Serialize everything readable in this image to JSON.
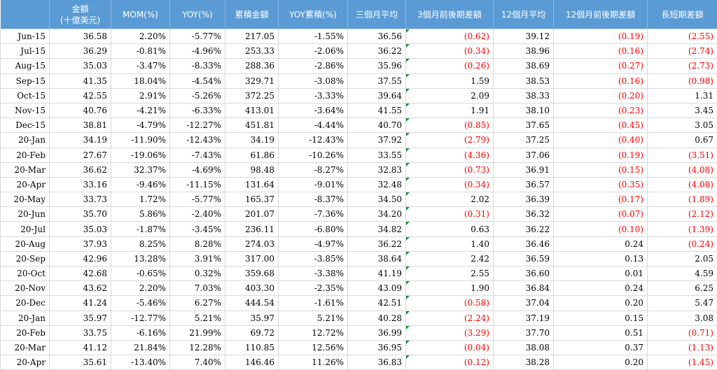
{
  "table": {
    "headers": [
      "",
      "金額\n(十億美元)",
      "MOM(%)",
      "YOY(%)",
      "累積金額",
      "YOY累積(%)",
      "三個月平均",
      "3個月前後期差額",
      "12個月平均",
      "12個月前後期差額",
      "長短期差額"
    ],
    "rows": [
      [
        "Jun-15",
        "36.58",
        "2.20%",
        "-5.77%",
        "217.05",
        "-1.55%",
        "36.56",
        "(0.62)",
        "39.12",
        "(0.19)",
        "(2.55)"
      ],
      [
        "Jul-15",
        "36.29",
        "-0.81%",
        "-4.96%",
        "253.33",
        "-2.06%",
        "36.22",
        "(0.34)",
        "38.96",
        "(0.16)",
        "(2.74)"
      ],
      [
        "Aug-15",
        "35.03",
        "-3.47%",
        "-8.33%",
        "288.36",
        "-2.86%",
        "35.96",
        "(0.26)",
        "38.69",
        "(0.27)",
        "(2.73)"
      ],
      [
        "Sep-15",
        "41.35",
        "18.04%",
        "-4.54%",
        "329.71",
        "-3.08%",
        "37.55",
        "1.59",
        "38.53",
        "(0.16)",
        "(0.98)"
      ],
      [
        "Oct-15",
        "42.55",
        "2.91%",
        "-5.26%",
        "372.25",
        "-3.33%",
        "39.64",
        "2.09",
        "38.33",
        "(0.20)",
        "1.31"
      ],
      [
        "Nov-15",
        "40.76",
        "-4.21%",
        "-6.33%",
        "413.01",
        "-3.64%",
        "41.55",
        "1.91",
        "38.10",
        "(0.23)",
        "3.45"
      ],
      [
        "Dec-15",
        "38.81",
        "-4.79%",
        "-12.27%",
        "451.81",
        "-4.44%",
        "40.70",
        "(0.85)",
        "37.65",
        "(0.45)",
        "3.05"
      ],
      [
        "20-Jan",
        "34.19",
        "-11.90%",
        "-12.43%",
        "34.19",
        "-12.43%",
        "37.92",
        "(2.79)",
        "37.25",
        "(0.40)",
        "0.67"
      ],
      [
        "20-Feb",
        "27.67",
        "-19.06%",
        "-7.43%",
        "61.86",
        "-10.26%",
        "33.55",
        "(4.36)",
        "37.06",
        "(0.19)",
        "(3.51)"
      ],
      [
        "20-Mar",
        "36.62",
        "32.37%",
        "-4.69%",
        "98.48",
        "-8.27%",
        "32.83",
        "(0.73)",
        "36.91",
        "(0.15)",
        "(4.08)"
      ],
      [
        "20-Apr",
        "33.16",
        "-9.46%",
        "-11.15%",
        "131.64",
        "-9.01%",
        "32.48",
        "(0.34)",
        "36.57",
        "(0.35)",
        "(4.08)"
      ],
      [
        "20-May",
        "33.73",
        "1.72%",
        "-5.77%",
        "165.37",
        "-8.37%",
        "34.50",
        "2.02",
        "36.39",
        "(0.17)",
        "(1.89)"
      ],
      [
        "20-Jun",
        "35.70",
        "5.86%",
        "-2.40%",
        "201.07",
        "-7.36%",
        "34.20",
        "(0.31)",
        "36.32",
        "(0.07)",
        "(2.12)"
      ],
      [
        "20-Jul",
        "35.03",
        "-1.87%",
        "-3.45%",
        "236.11",
        "-6.80%",
        "34.82",
        "0.63",
        "36.22",
        "(0.10)",
        "(1.39)"
      ],
      [
        "20-Aug",
        "37.93",
        "8.25%",
        "8.28%",
        "274.03",
        "-4.97%",
        "36.22",
        "1.40",
        "36.46",
        "0.24",
        "(0.24)"
      ],
      [
        "20-Sep",
        "42.96",
        "13.28%",
        "3.91%",
        "317.00",
        "-3.85%",
        "38.64",
        "2.42",
        "36.59",
        "0.13",
        "2.05"
      ],
      [
        "20-Oct",
        "42.68",
        "-0.65%",
        "0.32%",
        "359.68",
        "-3.38%",
        "41.19",
        "2.55",
        "36.60",
        "0.01",
        "4.59"
      ],
      [
        "20-Nov",
        "43.62",
        "2.20%",
        "7.03%",
        "403.30",
        "-2.35%",
        "43.09",
        "1.90",
        "36.84",
        "0.24",
        "6.25"
      ],
      [
        "20-Dec",
        "41.24",
        "-5.46%",
        "6.27%",
        "444.54",
        "-1.61%",
        "42.51",
        "(0.58)",
        "37.04",
        "0.20",
        "5.47"
      ],
      [
        "20-Jan",
        "35.97",
        "-12.77%",
        "5.21%",
        "35.97",
        "5.21%",
        "40.28",
        "(2.24)",
        "37.19",
        "0.15",
        "3.08"
      ],
      [
        "20-Feb",
        "33.75",
        "-6.16%",
        "21.99%",
        "69.72",
        "12.72%",
        "36.99",
        "(3.29)",
        "37.70",
        "0.51",
        "(0.71)"
      ],
      [
        "20-Mar",
        "41.12",
        "21.84%",
        "12.28%",
        "110.85",
        "12.56%",
        "36.95",
        "(0.04)",
        "38.08",
        "0.37",
        "(1.13)"
      ],
      [
        "20-Apr",
        "35.61",
        "-13.40%",
        "7.40%",
        "146.46",
        "11.26%",
        "36.83",
        "(0.12)",
        "38.28",
        "0.20",
        "(1.45)"
      ]
    ]
  },
  "colors": {
    "header_bg": "#5b9bd5",
    "header_text": "#ffffff",
    "negative": "#ff0000",
    "marker": "#1e8c3c"
  }
}
